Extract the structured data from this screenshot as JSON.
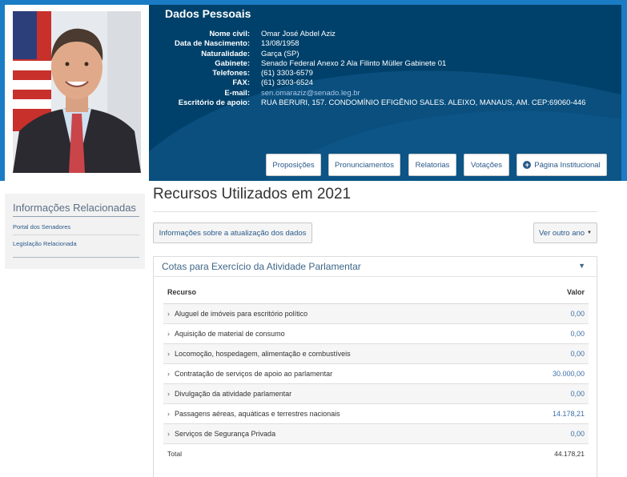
{
  "header": {
    "title": "Dados Pessoais",
    "fields": [
      {
        "label": "Nome civil:",
        "value": "Omar José Abdel Aziz"
      },
      {
        "label": "Data de Nascimento:",
        "value": "13/08/1958"
      },
      {
        "label": "Naturalidade:",
        "value": "Garça (SP)"
      },
      {
        "label": "Gabinete:",
        "value": "Senado Federal Anexo 2 Ala Filinto Müller Gabinete 01"
      },
      {
        "label": "Telefones:",
        "value": "(61) 3303-6579"
      },
      {
        "label": "FAX:",
        "value": "(61) 3303-6524"
      },
      {
        "label": "E-mail:",
        "value": "sen.omaraziz@senado.leg.br"
      },
      {
        "label": "Escritório de apoio:",
        "value": "RUA BERURI, 157. CONDOMÍNIO EFIGÊNIO SALES. ALEIXO, MANAUS, AM. CEP:69060-446"
      }
    ],
    "buttons": {
      "proposicoes": "Proposições",
      "pronunciamentos": "Pronunciamentos",
      "relatorias": "Relatorias",
      "votacoes": "Votações",
      "pagina_institucional": "Página Institucional"
    }
  },
  "sidebar": {
    "title": "Informações Relacionadas",
    "links": [
      "Portal dos Senadores",
      "Legislação Relacionada"
    ]
  },
  "main": {
    "title": "Recursos Utilizados em 2021",
    "info_button": "Informações sobre a atualização dos dados",
    "year_button": "Ver outro ano",
    "panel": {
      "title": "Cotas para Exercício da Atividade Parlamentar",
      "col_resource": "Recurso",
      "col_value": "Valor",
      "rows": [
        {
          "label": "Aluguel de imóveis para escritório político",
          "value": "0,00"
        },
        {
          "label": "Aquisição de material de consumo",
          "value": "0,00"
        },
        {
          "label": "Locomoção, hospedagem, alimentação e combustíveis",
          "value": "0,00"
        },
        {
          "label": "Contratação de serviços de apoio ao parlamentar",
          "value": "30.000,00"
        },
        {
          "label": "Divulgação da atividade parlamentar",
          "value": "0,00"
        },
        {
          "label": "Passagens aéreas, aquáticas e terrestres nacionais",
          "value": "14.178,21"
        },
        {
          "label": "Serviços de Segurança Privada",
          "value": "0,00"
        }
      ],
      "total_label": "Total",
      "total_value": "44.178,21"
    }
  },
  "colors": {
    "header_bg": "#00416b",
    "header_accent": "#1a7cc4",
    "link": "#2a5a8a",
    "value_blue": "#3d6fa6"
  }
}
